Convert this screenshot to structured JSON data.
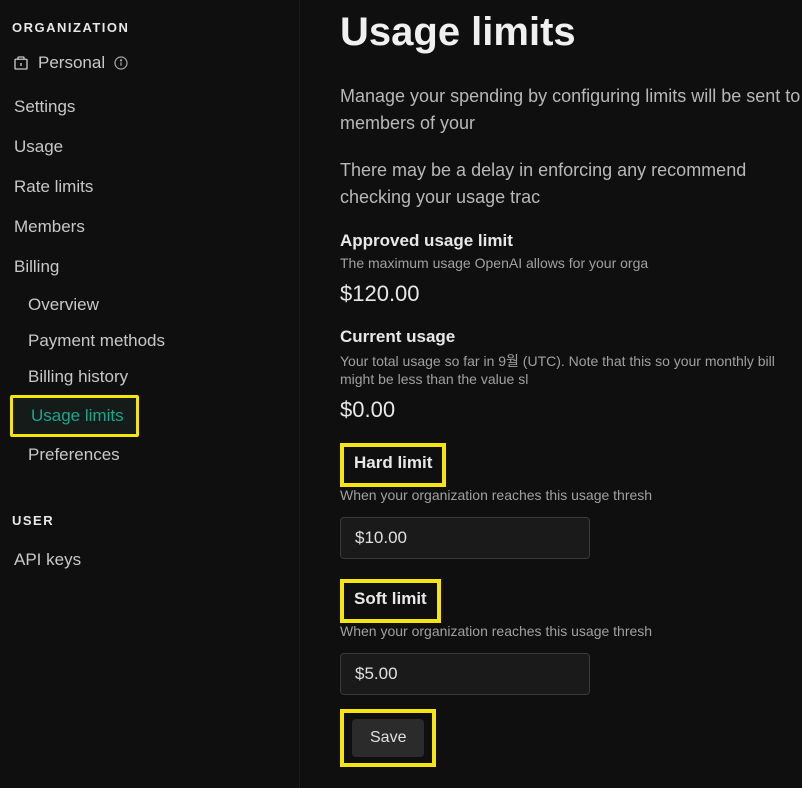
{
  "sidebar": {
    "org_heading": "ORGANIZATION",
    "org_name": "Personal",
    "nav": {
      "settings": "Settings",
      "usage": "Usage",
      "rate_limits": "Rate limits",
      "members": "Members",
      "billing": "Billing"
    },
    "billing_sub": {
      "overview": "Overview",
      "payment_methods": "Payment methods",
      "billing_history": "Billing history",
      "usage_limits": "Usage limits",
      "preferences": "Preferences"
    },
    "user_heading": "USER",
    "user_nav": {
      "api_keys": "API keys"
    }
  },
  "main": {
    "title": "Usage limits",
    "desc1": "Manage your spending by configuring limits will be sent to members of your",
    "desc2": "There may be a delay in enforcing any recommend checking your usage trac",
    "approved": {
      "label": "Approved usage limit",
      "hint": "The maximum usage OpenAI allows for your orga",
      "value": "$120.00"
    },
    "current": {
      "label": "Current usage",
      "hint": "Your total usage so far in 9월 (UTC). Note that this so your monthly bill might be less than the value sl",
      "value": "$0.00"
    },
    "hard": {
      "label": "Hard limit",
      "hint": "When your organization reaches this usage thresh",
      "value": "$10.00"
    },
    "soft": {
      "label": "Soft limit",
      "hint": "When your organization reaches this usage thresh",
      "value": "$5.00"
    },
    "save_label": "Save"
  }
}
